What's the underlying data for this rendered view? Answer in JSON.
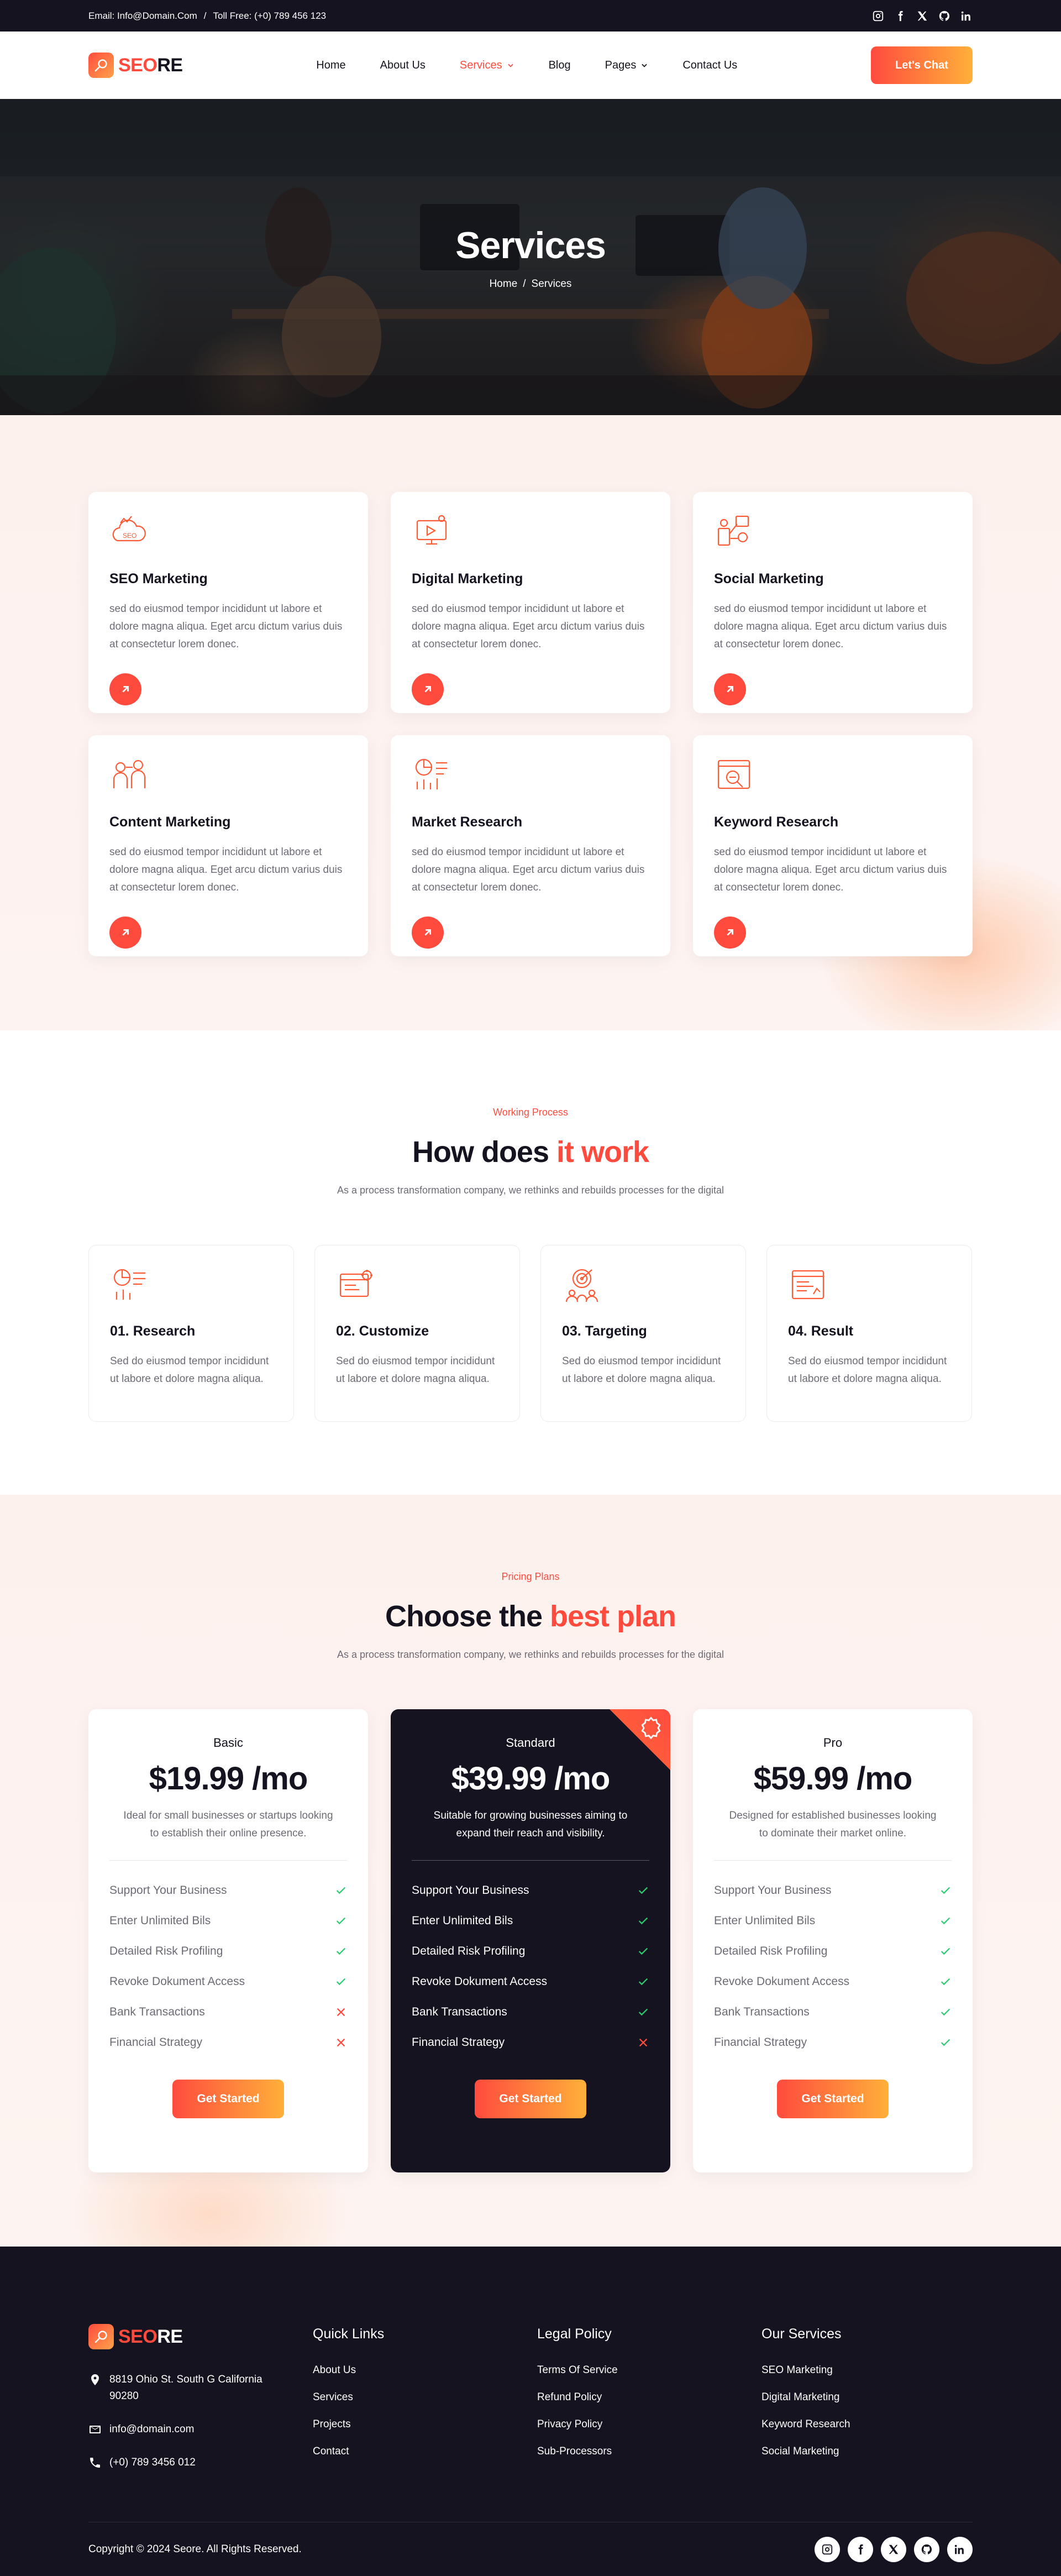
{
  "topbar": {
    "email": "Email: Info@Domain.Com",
    "separator": "/",
    "phone": "Toll Free: (+0) 789 456 123",
    "socials": [
      "instagram-icon",
      "facebook-icon",
      "x-icon",
      "github-icon",
      "linkedin-icon"
    ]
  },
  "brand": {
    "part1": "SEO",
    "part2": "RE",
    "accent": "#ff4b3e",
    "accent_end": "#ffb03a",
    "dark": "#14131f"
  },
  "nav": {
    "home": "Home",
    "about": "About Us",
    "services": "Services",
    "blog": "Blog",
    "pages": "Pages",
    "contact": "Contact Us",
    "cta": "Let's Chat"
  },
  "hero": {
    "title": "Services",
    "crumb_home": "Home",
    "crumb_sep": "/",
    "crumb_current": "Services"
  },
  "services": [
    {
      "title": "SEO Marketing",
      "text": "sed do eiusmod tempor incididunt ut labore et dolore magna aliqua. Eget arcu dictum varius duis at consectetur lorem donec.",
      "icon": "seo-icon"
    },
    {
      "title": "Digital Marketing",
      "text": "sed do eiusmod tempor incididunt ut labore et dolore magna aliqua. Eget arcu dictum varius duis at consectetur lorem donec.",
      "icon": "digital-marketing-icon"
    },
    {
      "title": "Social Marketing",
      "text": "sed do eiusmod tempor incididunt ut labore et dolore magna aliqua. Eget arcu dictum varius duis at consectetur lorem donec.",
      "icon": "social-network-icon"
    },
    {
      "title": "Content Marketing",
      "text": "sed do eiusmod tempor incididunt ut labore et dolore magna aliqua. Eget arcu dictum varius duis at consectetur lorem donec.",
      "icon": "content-icon"
    },
    {
      "title": "Market Research",
      "text": "sed do eiusmod tempor incididunt ut labore et dolore magna aliqua. Eget arcu dictum varius duis at consectetur lorem donec.",
      "icon": "research-chart-icon"
    },
    {
      "title": "Keyword Research",
      "text": "sed do eiusmod tempor incididunt ut labore et dolore magna aliqua. Eget arcu dictum varius duis at consectetur lorem donec.",
      "icon": "keyword-search-icon"
    }
  ],
  "process": {
    "kicker": "Working Process",
    "title_main": "How does ",
    "title_hl": "it work",
    "subtitle": "As a process transformation company, we rethinks and rebuilds processes for the digital",
    "steps": [
      {
        "title": "01. Research",
        "text": "Sed do eiusmod tempor incididunt ut labore et dolore magna aliqua.",
        "icon": "research-icon"
      },
      {
        "title": "02. Customize",
        "text": "Sed do eiusmod tempor incididunt ut labore et dolore magna aliqua.",
        "icon": "customize-icon"
      },
      {
        "title": "03. Targeting",
        "text": "Sed do eiusmod tempor incididunt ut labore et dolore magna aliqua.",
        "icon": "target-icon"
      },
      {
        "title": "04. Result",
        "text": "Sed do eiusmod tempor incididunt ut labore et dolore magna aliqua.",
        "icon": "result-icon"
      }
    ]
  },
  "pricing": {
    "kicker": "Pricing Plans",
    "title_main": "Choose the ",
    "title_hl": "best plan",
    "subtitle": "As a process transformation company, we rethinks and rebuilds processes for the digital",
    "plans": [
      {
        "name": "Basic",
        "price": "$19.99 /mo",
        "desc": "Ideal for small businesses or startups looking to establish their online presence.",
        "features": [
          {
            "label": "Support Your Business",
            "included": true
          },
          {
            "label": "Enter Unlimited Bils",
            "included": true
          },
          {
            "label": "Detailed Risk Profiling",
            "included": true
          },
          {
            "label": "Revoke Dokument Access",
            "included": true
          },
          {
            "label": "Bank Transactions",
            "included": false
          },
          {
            "label": "Financial Strategy",
            "included": false
          }
        ],
        "cta": "Get Started"
      },
      {
        "name": "Standard",
        "price": "$39.99 /mo",
        "desc": "Suitable for growing businesses aiming to expand their reach and visibility.",
        "features": [
          {
            "label": "Support Your Business",
            "included": true
          },
          {
            "label": "Enter Unlimited Bils",
            "included": true
          },
          {
            "label": "Detailed Risk Profiling",
            "included": true
          },
          {
            "label": "Revoke Dokument Access",
            "included": true
          },
          {
            "label": "Bank Transactions",
            "included": true
          },
          {
            "label": "Financial Strategy",
            "included": false
          }
        ],
        "cta": "Get Started"
      },
      {
        "name": "Pro",
        "price": "$59.99 /mo",
        "desc": "Designed for established businesses looking to dominate their market online.",
        "features": [
          {
            "label": "Support Your Business",
            "included": true
          },
          {
            "label": "Enter Unlimited Bils",
            "included": true
          },
          {
            "label": "Detailed Risk Profiling",
            "included": true
          },
          {
            "label": "Revoke Dokument Access",
            "included": true
          },
          {
            "label": "Bank Transactions",
            "included": true
          },
          {
            "label": "Financial Strategy",
            "included": true
          }
        ],
        "cta": "Get Started"
      }
    ]
  },
  "footer": {
    "address": "8819 Ohio St. South G California 90280",
    "email": "info@domain.com",
    "phone": "(+0) 789 3456 012",
    "quick_links_title": "Quick Links",
    "quick_links": [
      "About Us",
      "Services",
      "Projects",
      "Contact"
    ],
    "legal_title": "Legal Policy",
    "legal_links": [
      "Terms Of Service",
      "Refund Policy",
      "Privacy Policy",
      "Sub-Processors"
    ],
    "services_title": "Our Services",
    "service_links": [
      "SEO Marketing",
      "Digital Marketing",
      "Keyword Research",
      "Social Marketing"
    ],
    "copyright": "Copyright © 2024 Seore. All Rights Reserved.",
    "socials": [
      "instagram-icon",
      "facebook-icon",
      "x-icon",
      "github-icon",
      "linkedin-icon"
    ]
  }
}
